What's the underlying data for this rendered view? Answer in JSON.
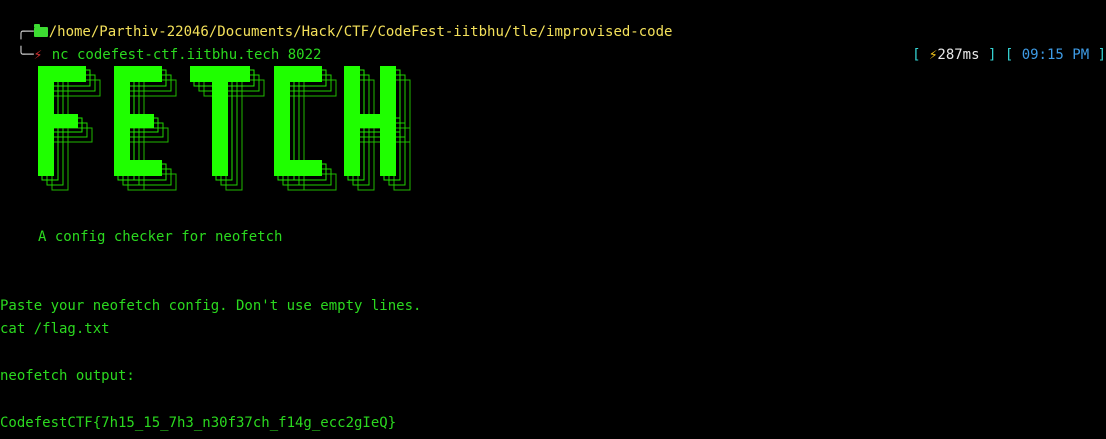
{
  "prompt": {
    "tree_top": "╭─",
    "path": "/home/Parthiv-22046/Documents/Hack/CTF/CodeFest-iitbhu/tle/improvised-code",
    "tree_bottom": "╰─",
    "command": "nc codefest-ctf.iitbhu.tech 8022",
    "icons": {
      "folder": "folder-icon",
      "shell": "shell-icon",
      "bolt": "lightning-icon"
    }
  },
  "status": {
    "open1": "[ ",
    "latency": "287ms",
    "close1": " ]",
    "open2": " [ ",
    "time": "09:15 PM",
    "close2": " ]"
  },
  "banner": {
    "text": "FETCH",
    "color": "#1fff00"
  },
  "output": {
    "tagline": "A config checker for neofetch",
    "paste_prompt": "Paste your neofetch config. Don't use empty lines.",
    "input_line": "cat /flag.txt",
    "output_label": "neofetch output:",
    "flag": "CodefestCTF{7h15_15_7h3_n30f37ch_f14g_ecc2gIeQ}"
  },
  "colors": {
    "background": "#000000",
    "green": "#2bd91f",
    "path_yellow": "#f3e05a",
    "cyan": "#35d4d4",
    "blue": "#3e9ce6",
    "red": "#d23131"
  }
}
